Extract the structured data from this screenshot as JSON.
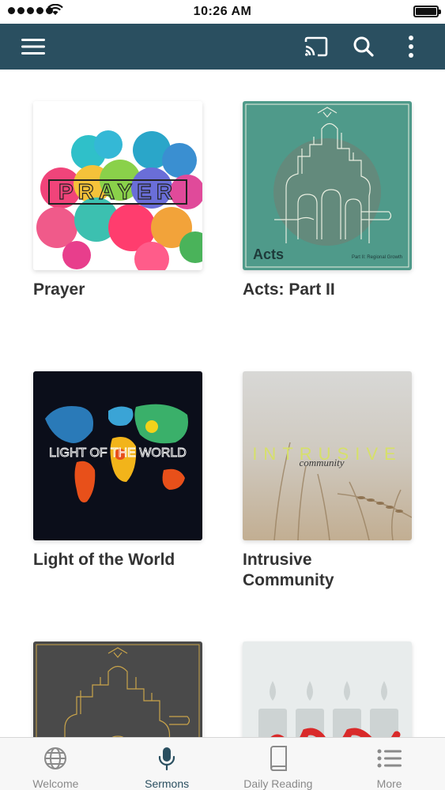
{
  "status_bar": {
    "time": "10:26 AM"
  },
  "app_bar": {
    "icons": [
      "menu-icon",
      "cast-icon",
      "search-icon",
      "more-vertical-icon"
    ],
    "color": "#2a4f60"
  },
  "sermons": [
    {
      "title": "Prayer",
      "artwork_text": "PRAYER"
    },
    {
      "title": "Acts: Part II",
      "artwork_text": "Acts",
      "artwork_subtext": "Part II: Regional Growth"
    },
    {
      "title": "Light of the World",
      "artwork_text": "LIGHT OF THE WORLD"
    },
    {
      "title": "Intrusive Community",
      "artwork_text": "INTRUSIVE",
      "artwork_subtext": "community"
    },
    {
      "title": ""
    },
    {
      "title": ""
    }
  ],
  "tabs": [
    {
      "label": "Welcome",
      "icon": "globe-icon",
      "active": false
    },
    {
      "label": "Sermons",
      "icon": "microphone-icon",
      "active": true
    },
    {
      "label": "Daily Reading",
      "icon": "book-icon",
      "active": false
    },
    {
      "label": "More",
      "icon": "list-icon",
      "active": false
    }
  ]
}
